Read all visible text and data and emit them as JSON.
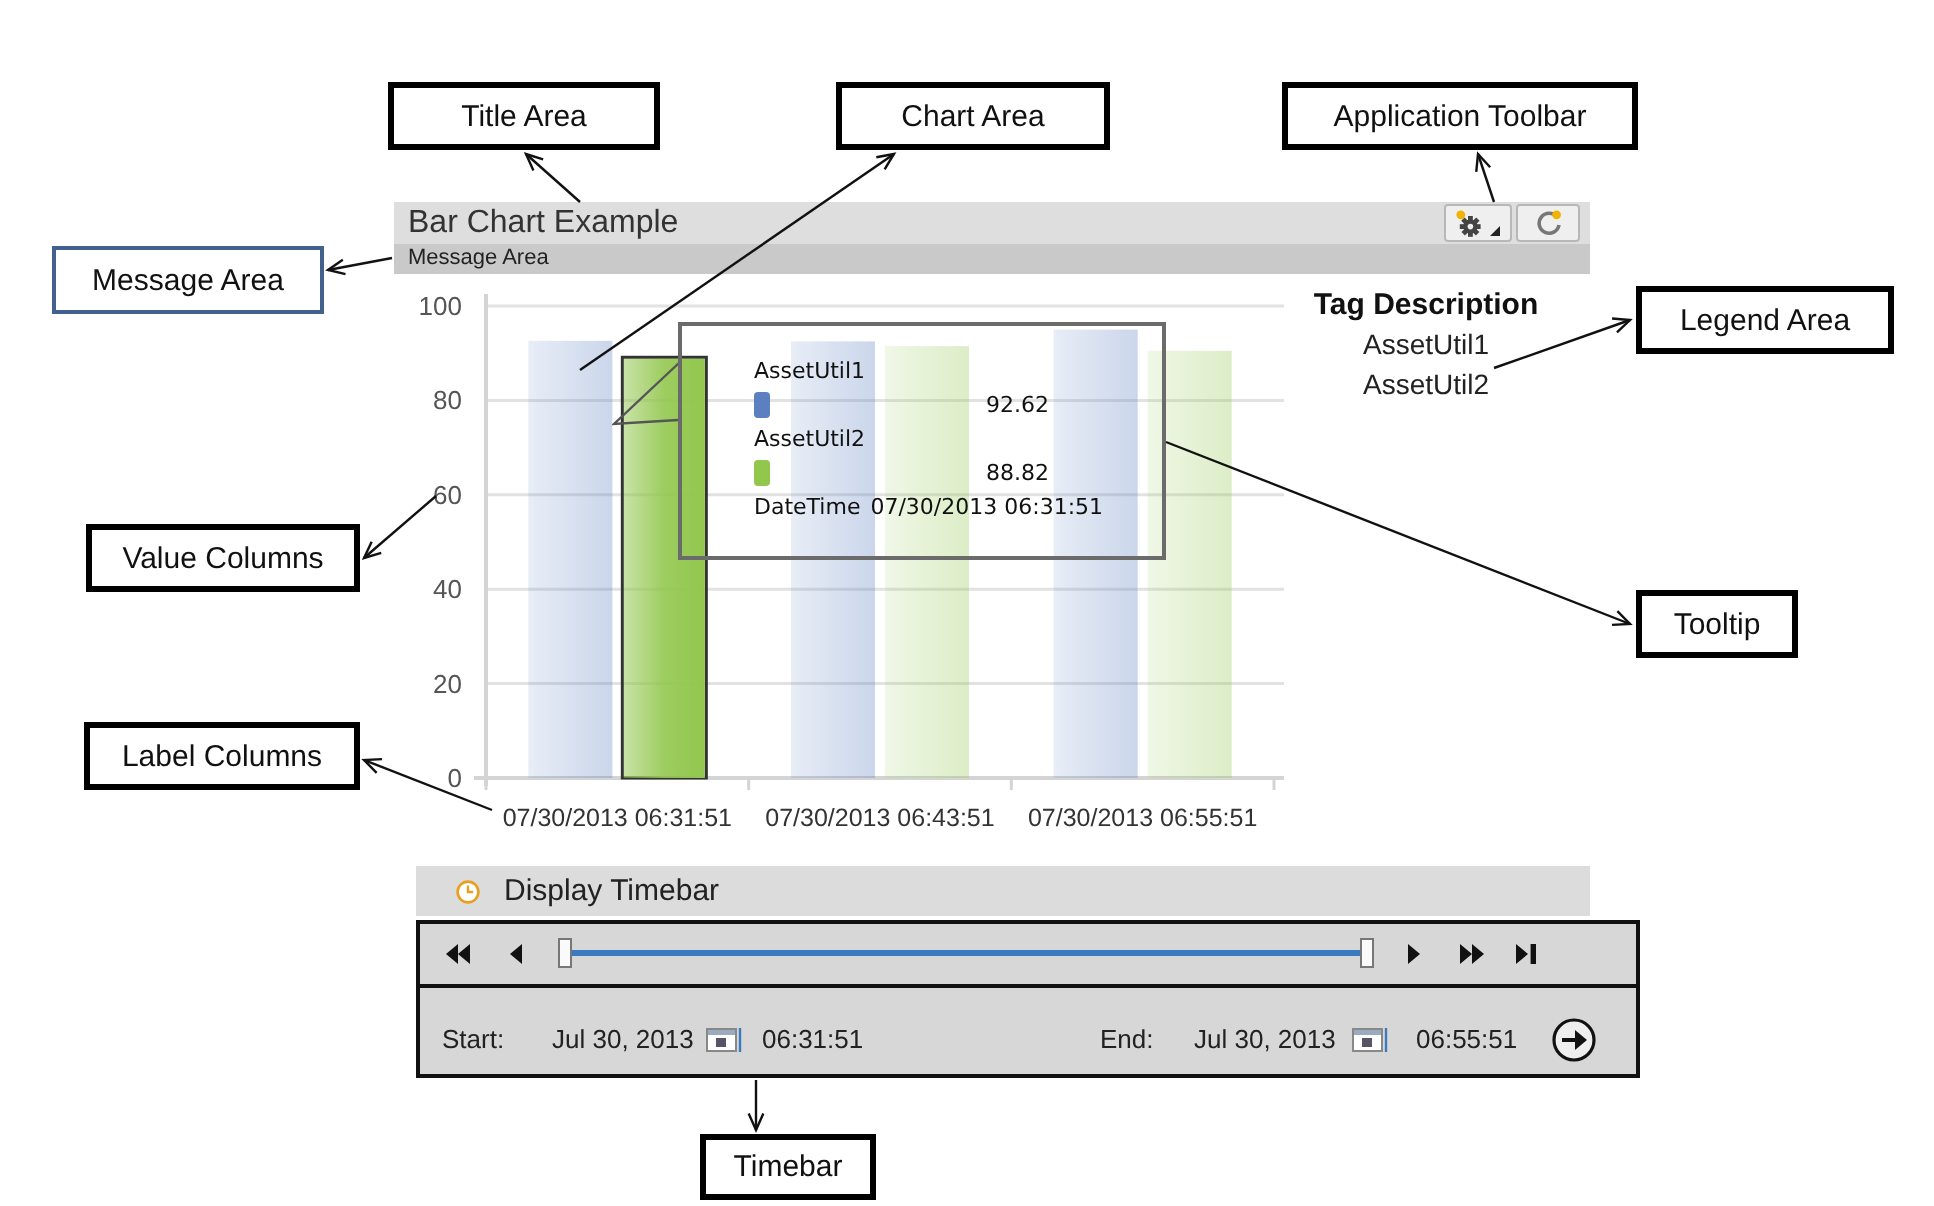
{
  "callouts": [
    {
      "label": "Title Area",
      "color": "#000000"
    },
    {
      "label": "Chart Area",
      "color": "#000000"
    },
    {
      "label": "Application Toolbar",
      "color": "#000000"
    },
    {
      "label": "Message Area",
      "color": "#44608f"
    },
    {
      "label": "Legend Area",
      "color": "#000000"
    },
    {
      "label": "Value Columns",
      "color": "#000000"
    },
    {
      "label": "Tooltip",
      "color": "#000000"
    },
    {
      "label": "Label Columns",
      "color": "#000000"
    },
    {
      "label": "Timebar",
      "color": "#000000"
    }
  ],
  "panel": {
    "title": "Bar Chart Example",
    "message": "Message Area",
    "toolbar": [
      {
        "kind": "settings"
      },
      {
        "kind": "refresh"
      }
    ]
  },
  "chart": {
    "chart_data": {
      "type": "bar",
      "categories": [
        "07/30/2013 06:31:51",
        "07/30/2013 06:43:51",
        "07/30/2013 06:55:51"
      ],
      "series": [
        {
          "name": "AssetUtil1",
          "color": "#5b7fc0",
          "values": [
            92.62,
            92.5,
            95
          ]
        },
        {
          "name": "AssetUtil2",
          "color": "#92c74e",
          "values": [
            88.82,
            91.5,
            90.5
          ]
        }
      ],
      "ylim": [
        0,
        100
      ],
      "yticks": [
        0,
        20,
        40,
        60,
        80,
        100
      ],
      "grid": true
    },
    "columns": [
      {
        "bars": [
          {
            "selected": false
          },
          {
            "selected": true
          }
        ]
      },
      {
        "bars": [
          {
            "selected": false
          },
          {
            "selected": false
          }
        ]
      },
      {
        "bars": [
          {
            "selected": false
          },
          {
            "selected": false
          }
        ]
      }
    ],
    "legend": {
      "title": "Tag Description"
    },
    "tooltip": {
      "rows": [
        {
          "name": "AssetUtil1",
          "color": "#5b7fc0",
          "value": "92.62"
        },
        {
          "name": "AssetUtil2",
          "color": "#92c74e",
          "value": "88.82"
        }
      ],
      "datetime_label": "DateTime",
      "datetime": "07/30/2013 06:31:51"
    }
  },
  "timebar": {
    "title": "Display Timebar",
    "slider": {
      "level": 1
    },
    "start": {
      "label": "Start:",
      "date": "Jul 30, 2013",
      "time": "06:31:51"
    },
    "end": {
      "label": "End:",
      "date": "Jul 30, 2013",
      "time": "06:55:51"
    }
  }
}
